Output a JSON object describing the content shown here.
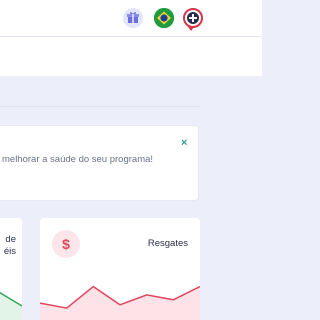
{
  "topbar": {
    "gift_icon": "gift-icon",
    "flag_icon": "brazil-flag-icon",
    "help_icon": "help-plus-icon"
  },
  "notice": {
    "text": "melhorar a saúde do seu programa!",
    "close_label": "×"
  },
  "cards": {
    "left": {
      "line1": "de",
      "line2": "éis"
    },
    "right": {
      "title": "Resgates",
      "icon": "dollar-icon",
      "icon_glyph": "$",
      "accent": "#e04660"
    }
  },
  "chart_data": {
    "type": "area",
    "series": [
      {
        "values": [
          35,
          32,
          45,
          34,
          40,
          37,
          45
        ]
      }
    ]
  }
}
